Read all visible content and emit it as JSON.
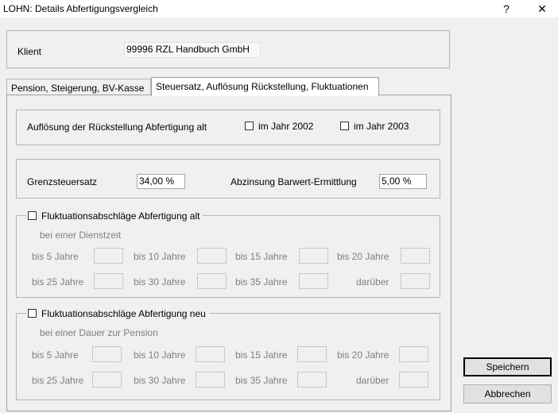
{
  "window": {
    "title": "LOHN: Details Abfertigungsvergleich",
    "help": "?",
    "close": "✕"
  },
  "client": {
    "label": "Klient",
    "value": "99996  RZL Handbuch GmbH"
  },
  "tabs": [
    {
      "label": "Pension, Steigerung, BV-Kasse"
    },
    {
      "label": "Steuersatz, Auflösung Rückstellung, Fluktuationen"
    }
  ],
  "aufloesung": {
    "label": "Auflösung der Rückstellung Abfertigung alt",
    "jahr2002": "im Jahr 2002",
    "jahr2003": "im Jahr 2003"
  },
  "steuer": {
    "grenz_label": "Grenzsteuersatz",
    "grenz_value": "34,00  %",
    "abz_label": "Abzinsung Barwert-Ermittlung",
    "abz_value": "5,00  %"
  },
  "fluk_alt": {
    "title": "Fluktuationsabschläge Abfertigung alt",
    "subtitle": "bei einer Dienstzeit",
    "labels": [
      "bis  5 Jahre",
      "bis 10 Jahre",
      "bis 15 Jahre",
      "bis 20 Jahre",
      "bis 25 Jahre",
      "bis 30 Jahre",
      "bis 35 Jahre",
      "darüber"
    ]
  },
  "fluk_neu": {
    "title": "Fluktuationsabschläge Abfertigung neu",
    "subtitle": "bei einer Dauer zur Pension",
    "labels": [
      "bis  5 Jahre",
      "bis 10 Jahre",
      "bis 15 Jahre",
      "bis 20 Jahre",
      "bis 25 Jahre",
      "bis 30 Jahre",
      "bis 35 Jahre",
      "darüber"
    ]
  },
  "buttons": {
    "save": "Speichern",
    "cancel": "Abbrechen"
  }
}
